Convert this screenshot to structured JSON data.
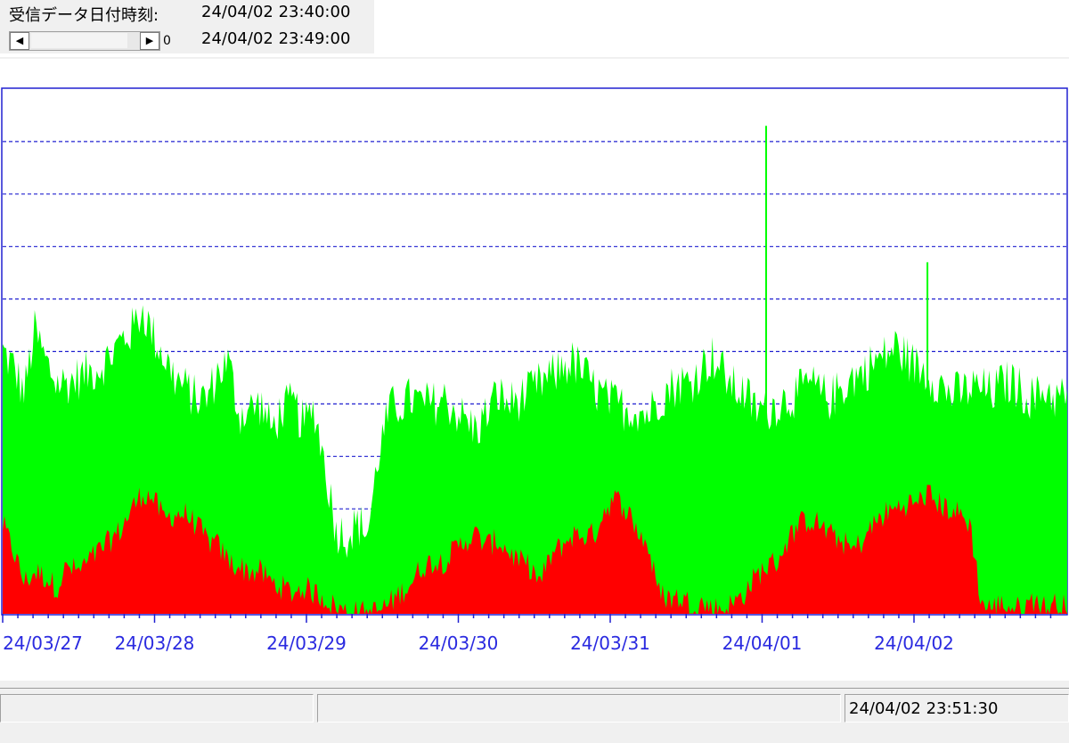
{
  "header": {
    "received_label": "受信データ日付時刻:",
    "start_time": "24/04/02 23:40:00",
    "end_time": "24/04/02 23:49:00",
    "scroll_value": "0",
    "scroll_left_icon": "arrow-left-icon",
    "scroll_right_icon": "arrow-right-icon"
  },
  "status_bar": {
    "pane1_text": "",
    "pane2_text": "",
    "current_time": "24/04/02 23:51:30"
  },
  "colors": {
    "green_series": "#00ff00",
    "red_series": "#ff0000",
    "grid": "#2020d0",
    "axis": "#2020d0",
    "tick_label": "#2a2ae0"
  },
  "chart_data": {
    "type": "area",
    "x_tick_labels": [
      "24/03/27",
      "24/03/28",
      "24/03/29",
      "24/03/30",
      "24/03/31",
      "24/04/01",
      "24/04/02"
    ],
    "x_start": "24/03/27",
    "x_end": "24/04/02 23:49",
    "grid": true,
    "grid_style": "dashed horizontal",
    "stacked": true,
    "y_max": 10,
    "series": [
      {
        "color": "#00ff00",
        "values": [
          5.0,
          4.7,
          4.2,
          5.4,
          4.8,
          4.4,
          4.4,
          4.5,
          4.6,
          4.7,
          4.9,
          5.2,
          5.4,
          5.8,
          5.3,
          4.9,
          4.5,
          4.3,
          4.1,
          4.1,
          4.6,
          4.8,
          3.8,
          3.9,
          4.0,
          3.5,
          3.9,
          4.0,
          3.6,
          3.9,
          2.8,
          1.6,
          1.5,
          1.7,
          1.6,
          3.1,
          3.9,
          4.0,
          4.1,
          4.0,
          4.0,
          4.1,
          3.9,
          3.7,
          3.5,
          3.8,
          4.2,
          4.0,
          4.1,
          4.2,
          4.4,
          4.5,
          4.7,
          4.8,
          4.6,
          4.3,
          4.1,
          4.0,
          3.9,
          3.9,
          3.8,
          4.1,
          4.3,
          4.4,
          4.4,
          4.7,
          4.9,
          4.6,
          4.3,
          4.2,
          3.9,
          3.9,
          4.0,
          4.1,
          4.2,
          4.4,
          4.2,
          4.1,
          4.3,
          4.5,
          4.6,
          4.8,
          4.9,
          5.1,
          4.9,
          4.7,
          4.6,
          4.4,
          4.2,
          4.2,
          4.3,
          4.3,
          4.2,
          4.4,
          4.4,
          4.2,
          4.1,
          4.3,
          4.1,
          4.2
        ],
        "spikes": [
          {
            "x_index": 71,
            "value": 9.3
          },
          {
            "x_index": 86,
            "value": 6.7
          }
        ]
      },
      {
        "color": "#ff0000",
        "values": [
          1.7,
          1.2,
          0.6,
          0.8,
          0.7,
          0.5,
          0.9,
          0.8,
          1.0,
          1.2,
          1.4,
          1.6,
          2.0,
          2.3,
          2.2,
          1.8,
          1.9,
          1.9,
          1.7,
          1.4,
          1.3,
          1.0,
          0.9,
          0.8,
          0.8,
          0.6,
          0.5,
          0.4,
          0.5,
          0.4,
          0.3,
          0.1,
          0.05,
          0.02,
          0.02,
          0.05,
          0.2,
          0.4,
          0.6,
          0.9,
          1.0,
          1.0,
          1.2,
          1.4,
          1.5,
          1.3,
          1.4,
          1.2,
          1.0,
          0.9,
          0.6,
          1.1,
          1.3,
          1.5,
          1.5,
          1.5,
          2.0,
          2.2,
          2.0,
          1.6,
          1.3,
          0.4,
          0.3,
          0.3,
          0.2,
          0.2,
          0.1,
          0.1,
          0.2,
          0.4,
          0.7,
          0.9,
          1.0,
          1.4,
          1.7,
          1.8,
          1.7,
          1.5,
          1.4,
          1.2,
          1.4,
          1.7,
          1.9,
          2.0,
          2.1,
          2.1,
          2.3,
          2.1,
          2.0,
          1.9,
          1.7,
          0.2,
          0.1,
          0.2,
          0.1,
          0.1,
          0.3,
          0.1,
          0.2,
          0.1
        ]
      }
    ]
  }
}
